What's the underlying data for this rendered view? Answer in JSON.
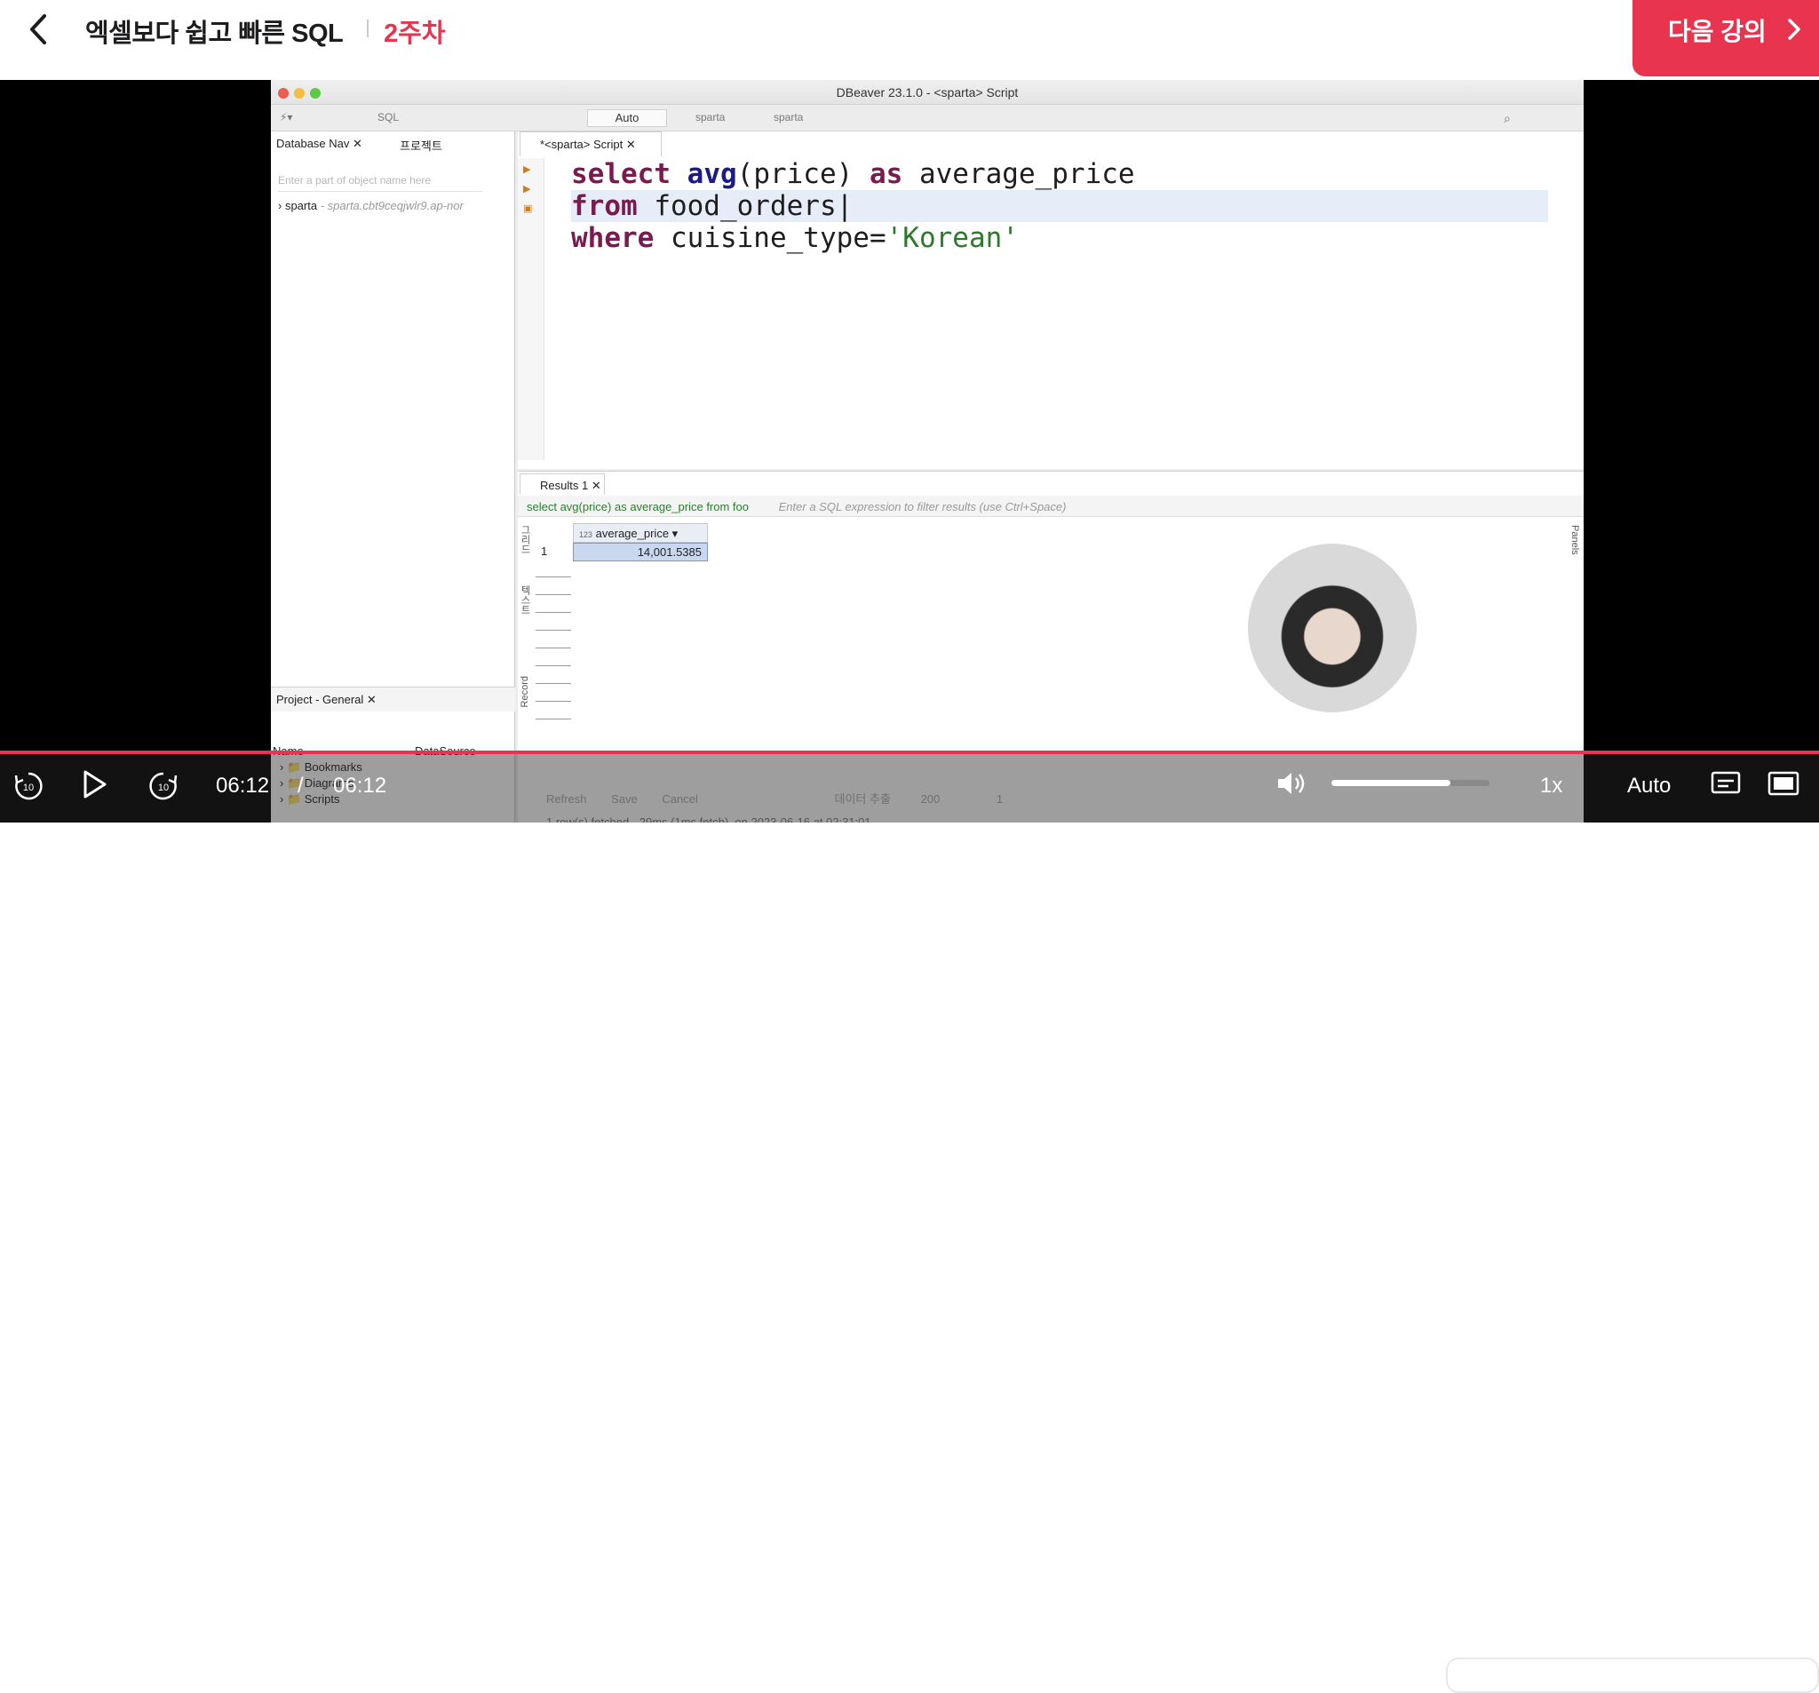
{
  "header": {
    "back_icon": "chevron-left-icon",
    "course_title": "엑셀보다 쉽고 빠른 SQL",
    "week": "2주차",
    "next_label": "다음 강의",
    "accent": "#e8344e"
  },
  "dbeaver": {
    "window_title": "DBeaver 23.1.0 - <sparta> Script",
    "toolbar": {
      "sql": "SQL",
      "mode": "Auto",
      "datasource": "sparta",
      "schema": "sparta"
    },
    "left": {
      "tab_nav": "Database Nav",
      "tab_project": "프로젝트",
      "filter_placeholder": "Enter a part of object name here",
      "tree_item": "sparta",
      "tree_item_host": "- sparta.cbt9ceqjwlr9.ap-nor",
      "project_tab": "Project - General",
      "col_name": "Name",
      "col_datasource": "DataSource",
      "items": [
        "Bookmarks",
        "Diagrams",
        "Scripts"
      ]
    },
    "editor": {
      "tab": "*<sparta> Script",
      "line1_kw1": "select",
      "line1_fn": "avg",
      "line1_mid": "(price) ",
      "line1_kw2": "as",
      "line1_end": " average_price",
      "line2_kw": "from",
      "line2_end": " food_orders",
      "line3_kw": "where",
      "line3_mid": " cuisine_type=",
      "line3_str": "'Korean'"
    },
    "results": {
      "tab": "Results 1",
      "query": "select avg(price) as average_price from foo",
      "filter_placeholder": "Enter a SQL expression to filter results (use Ctrl+Space)",
      "column": "average_price",
      "column_type": "123",
      "row_number": "1",
      "value": "14,001.5385",
      "side_grid": "그리드",
      "side_text": "텍스트",
      "side_record": "Record",
      "panels": "Panels",
      "toolbar_refresh": "Refresh",
      "toolbar_save": "Save",
      "toolbar_cancel": "Cancel",
      "toolbar_export": "데이터 추출",
      "fetch_size": "200",
      "row_count": "1",
      "status": "1 row(s) fetched - 29ms (1ms fetch), on 2023-06-16 at 02:31:01"
    }
  },
  "player": {
    "current_time": "06:12",
    "separator": "/",
    "duration": "06:12",
    "progress": 1.0,
    "volume": 0.75,
    "speed": "1x",
    "quality": "Auto",
    "rewind_label": "10",
    "forward_label": "10"
  }
}
